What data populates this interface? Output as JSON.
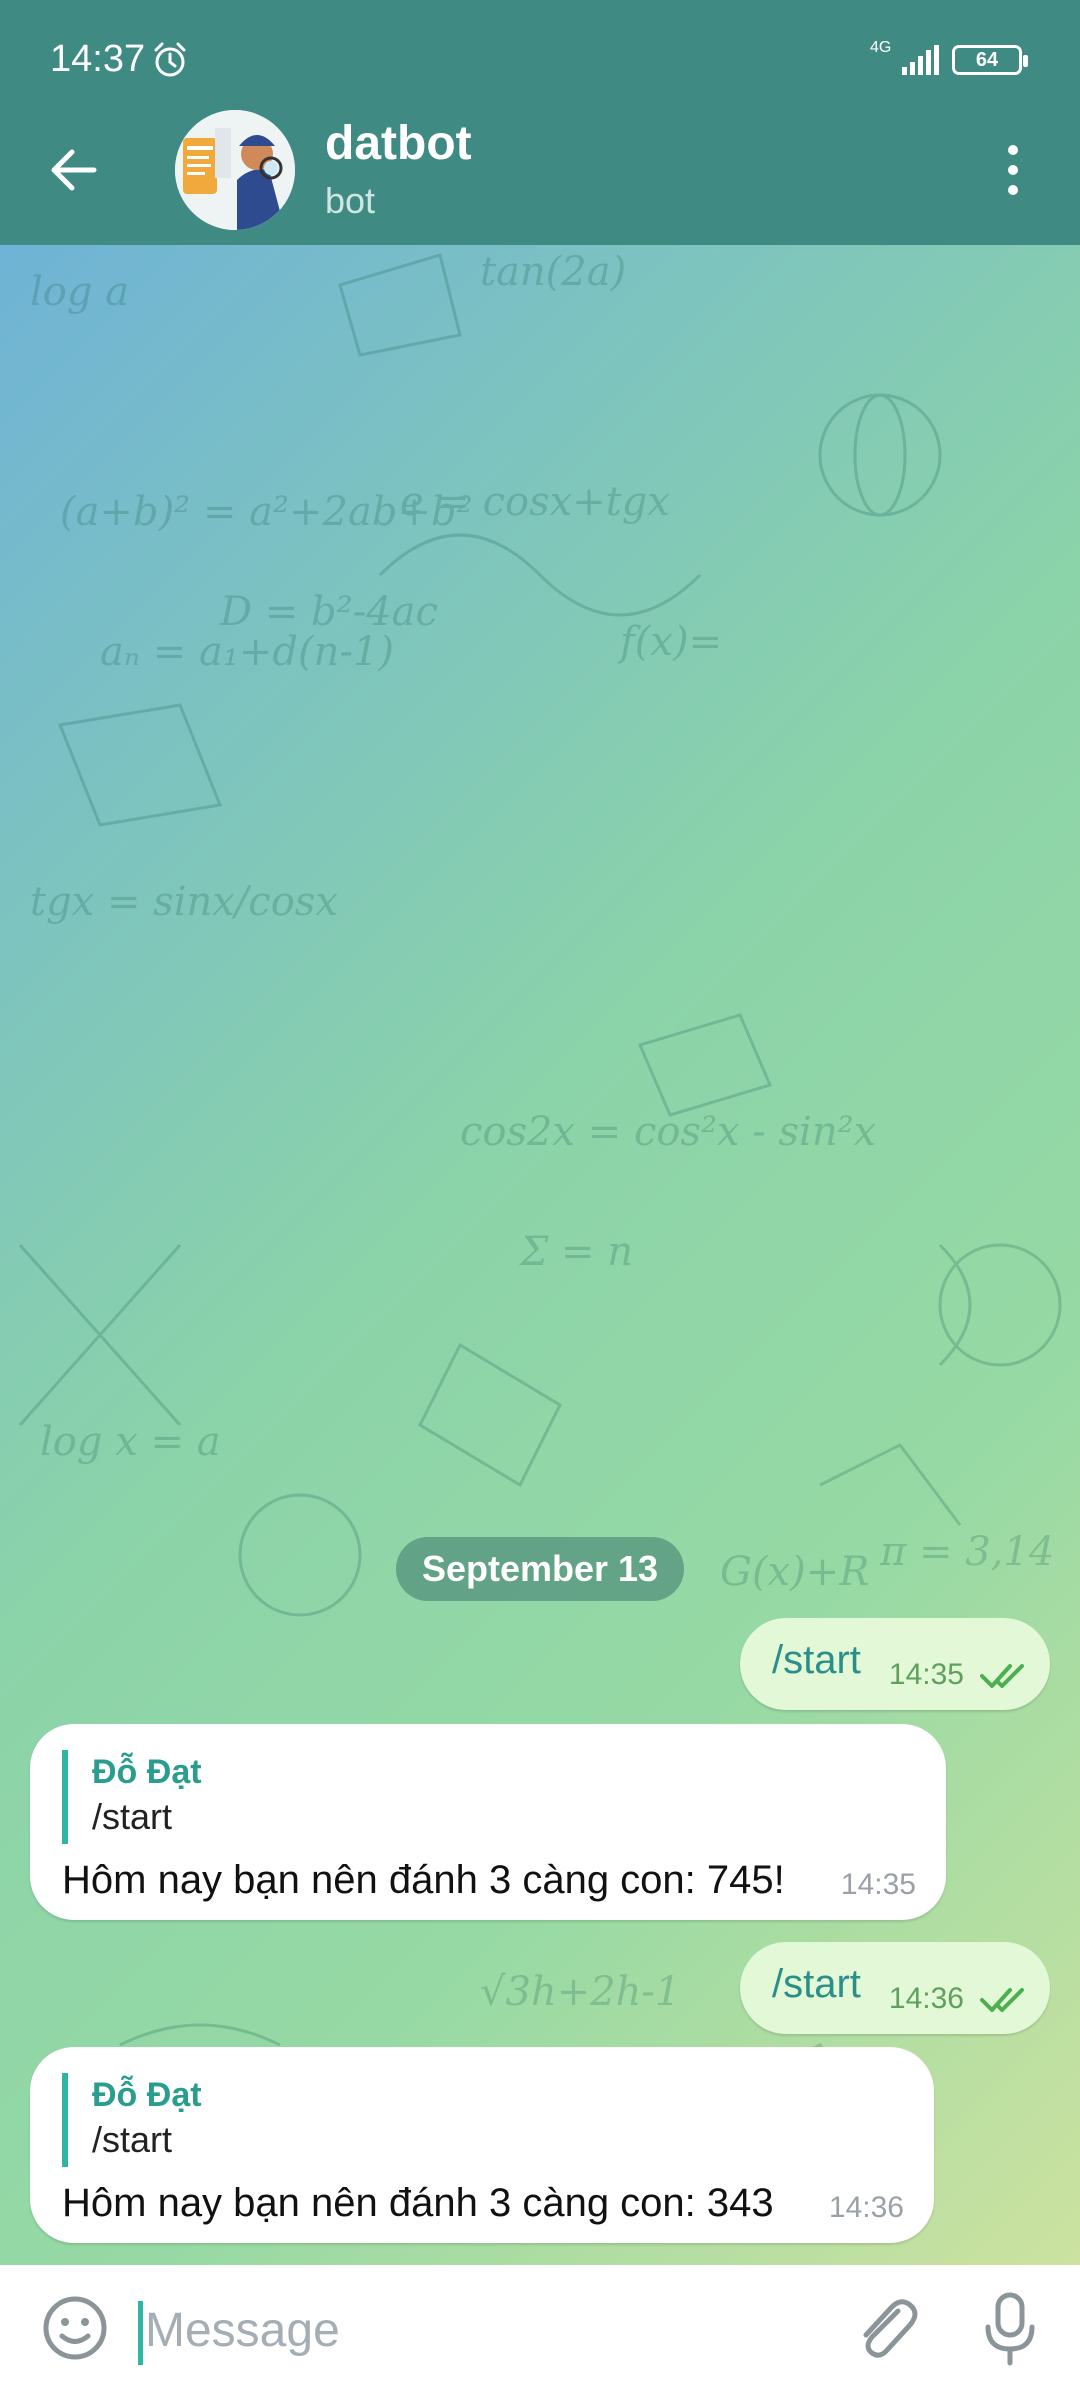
{
  "status_bar": {
    "time": "14:37",
    "network": "4G",
    "battery": "64",
    "alarm_icon": "alarm-clock-icon",
    "signal_icon": "signal-icon"
  },
  "header": {
    "title": "datbot",
    "subtitle": "bot",
    "back_icon": "arrow-left-icon",
    "menu_icon": "vertical-dots-icon"
  },
  "chat": {
    "date_separator": "September 13",
    "messages": [
      {
        "direction": "outgoing",
        "text": "/start",
        "time": "14:35",
        "status": "read"
      },
      {
        "direction": "incoming",
        "reply_name": "Đỗ Đạt",
        "reply_text": "/start",
        "text": "Hôm nay bạn nên đánh 3 càng con: 745!",
        "time": "14:35"
      },
      {
        "direction": "outgoing",
        "text": "/start",
        "time": "14:36",
        "status": "read"
      },
      {
        "direction": "incoming",
        "reply_name": "Đỗ Đạt",
        "reply_text": "/start",
        "text": "Hôm nay bạn nên đánh 3 càng con: 343",
        "time": "14:36"
      }
    ]
  },
  "composer": {
    "placeholder": "Message",
    "emoji_icon": "smiley-icon",
    "attach_icon": "paperclip-icon",
    "mic_icon": "microphone-icon"
  },
  "colors": {
    "header": "#3f8a83",
    "outgoing_bubble": "#e2f8d6",
    "incoming_bubble": "#ffffff",
    "accent": "#2fb6a2"
  }
}
